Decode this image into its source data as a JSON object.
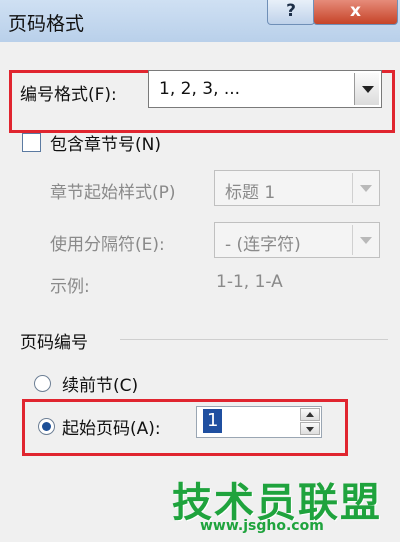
{
  "dialog": {
    "title": "页码格式",
    "help_label": "?",
    "close_label": "x"
  },
  "number_format": {
    "label": "编号格式(F):",
    "value": "1, 2, 3, ..."
  },
  "include_chapter": {
    "label": "包含章节号(N)",
    "checked": false
  },
  "chapter_style": {
    "label": "章节起始样式(P)",
    "value": "标题 1"
  },
  "separator": {
    "label": "使用分隔符(E):",
    "value": "-  (连字符)"
  },
  "example": {
    "label": "示例:",
    "value": "1-1, 1-A"
  },
  "page_numbering": {
    "group_label": "页码编号",
    "continue_label": "续前节(C)",
    "start_at_label": "起始页码(A):",
    "start_at_value": "1",
    "selected": "start_at"
  },
  "watermark": {
    "text": "技术员联盟",
    "url": "www.jsgho.com"
  },
  "colors": {
    "highlight": "#e0252f",
    "watermark": "#1fa33d",
    "selection": "#1f4fa0"
  }
}
